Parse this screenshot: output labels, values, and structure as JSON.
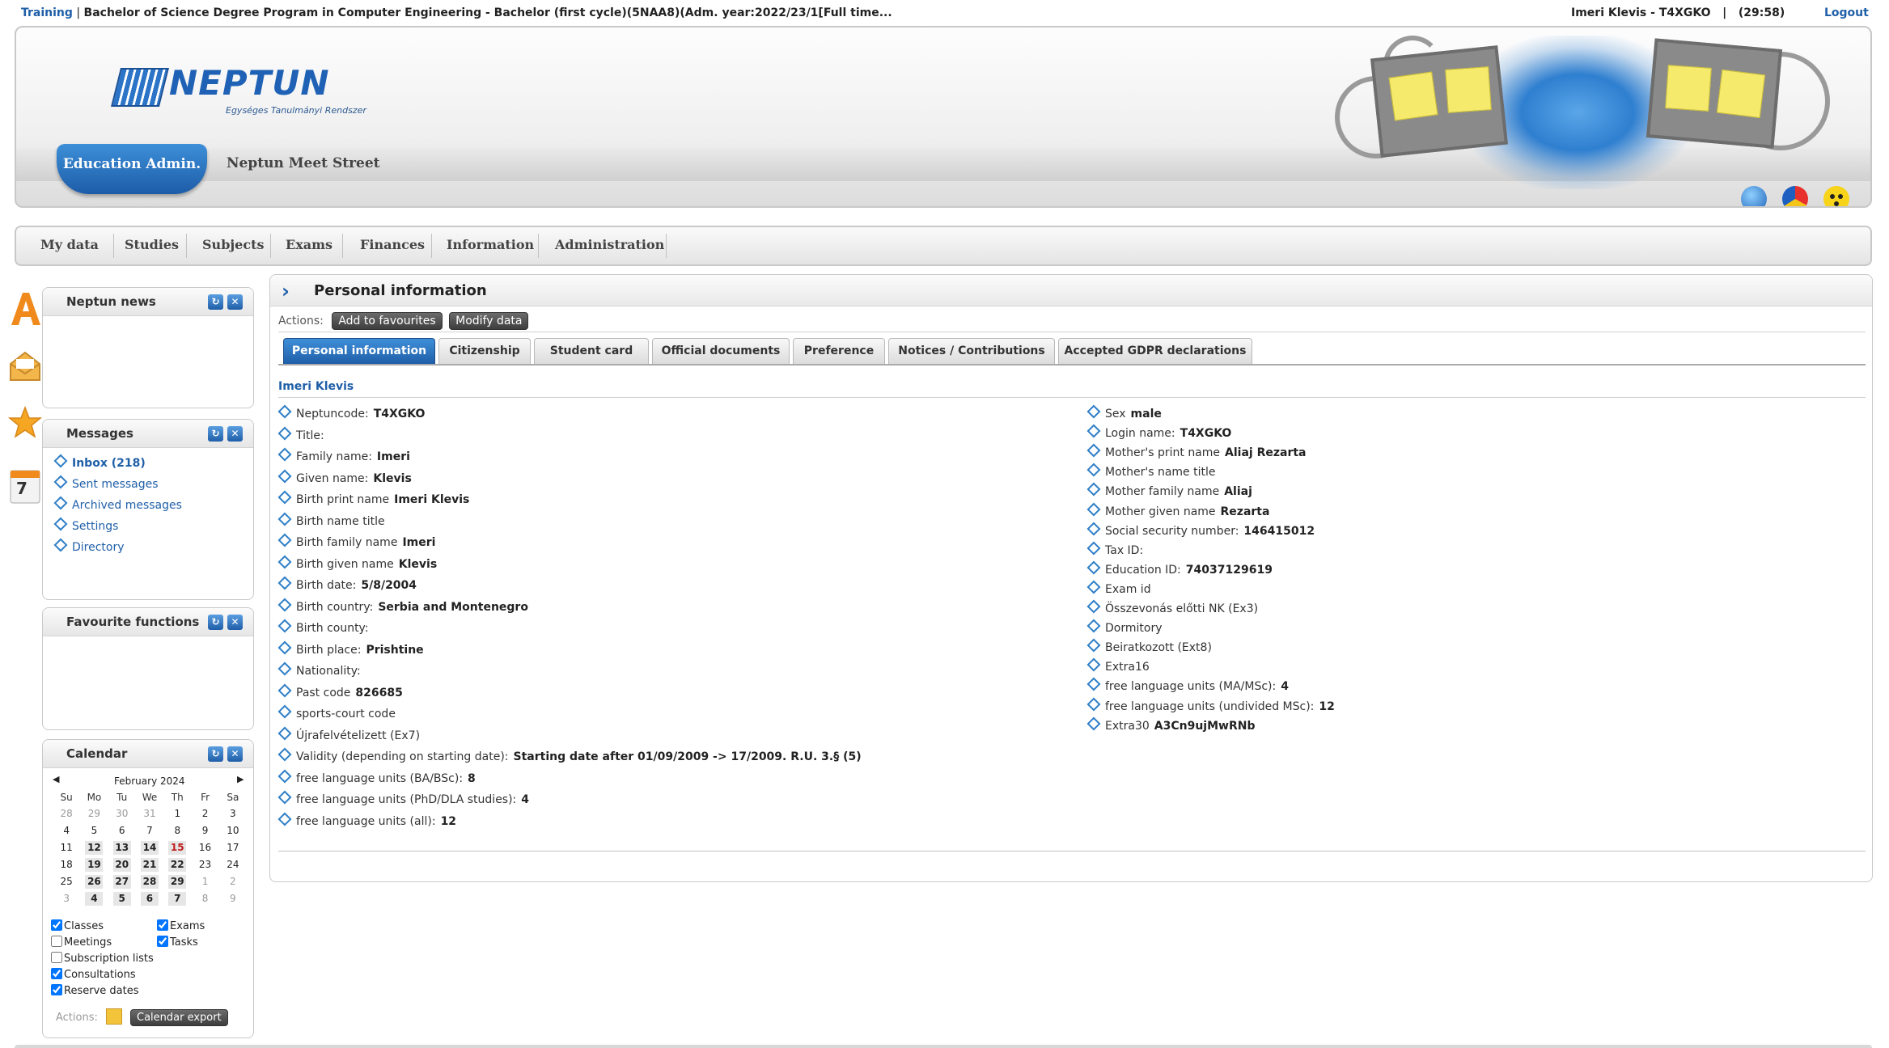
{
  "topbar": {
    "mode": "Training",
    "separator": " | ",
    "program": "Bachelor of Science Degree Program in Computer Engineering - Bachelor (first cycle)(5NAA8)(Adm. year:2022/23/1[Full time...",
    "user": "Imeri Klevis - T4XGKO",
    "user_sep": "|",
    "session_timer": "(29:58)",
    "logout": "Logout"
  },
  "header": {
    "logo_text": "NEPTUN",
    "logo_subtitle": "Egységes Tanulmányi Rendszer",
    "education_admin": "Education Admin.",
    "site_name": "Neptun Meet Street",
    "icons": [
      "globe-icon",
      "color-theme-icon",
      "accessibility-icon"
    ]
  },
  "nav": {
    "items": [
      "My data",
      "Studies",
      "Subjects",
      "Exams",
      "Finances",
      "Information",
      "Administration"
    ]
  },
  "sidebar": {
    "icons": [
      "font-size-icon",
      "inbox-envelope-icon",
      "favourite-star-icon",
      "calendar-icon"
    ],
    "calendar_icon_day": "7",
    "news": {
      "title": "Neptun news"
    },
    "messages": {
      "title": "Messages",
      "items": [
        "Inbox (218)",
        "Sent messages",
        "Archived messages",
        "Settings",
        "Directory"
      ]
    },
    "favourites": {
      "title": "Favourite functions"
    },
    "calendar": {
      "title": "Calendar",
      "month": "February 2024",
      "weekdays": [
        "Su",
        "Mo",
        "Tu",
        "We",
        "Th",
        "Fr",
        "Sa"
      ],
      "weeks": [
        [
          [
            "28",
            "dim"
          ],
          [
            "29",
            "dim"
          ],
          [
            "30",
            "dim"
          ],
          [
            "31",
            "dim"
          ],
          [
            "1",
            ""
          ],
          [
            "2",
            ""
          ],
          [
            "3",
            ""
          ]
        ],
        [
          [
            "4",
            ""
          ],
          [
            "5",
            ""
          ],
          [
            "6",
            ""
          ],
          [
            "7",
            ""
          ],
          [
            "8",
            ""
          ],
          [
            "9",
            ""
          ],
          [
            "10",
            ""
          ]
        ],
        [
          [
            "11",
            ""
          ],
          [
            "12",
            "bold"
          ],
          [
            "13",
            "bold"
          ],
          [
            "14",
            "bold"
          ],
          [
            "15",
            "bold today"
          ],
          [
            "16",
            ""
          ],
          [
            "17",
            ""
          ]
        ],
        [
          [
            "18",
            ""
          ],
          [
            "19",
            "bold"
          ],
          [
            "20",
            "bold"
          ],
          [
            "21",
            "bold"
          ],
          [
            "22",
            "bold"
          ],
          [
            "23",
            ""
          ],
          [
            "24",
            ""
          ]
        ],
        [
          [
            "25",
            ""
          ],
          [
            "26",
            "bold"
          ],
          [
            "27",
            "bold"
          ],
          [
            "28",
            "bold"
          ],
          [
            "29",
            "bold"
          ],
          [
            "1",
            "dim"
          ],
          [
            "2",
            "dim"
          ]
        ],
        [
          [
            "3",
            "dim"
          ],
          [
            "4",
            "bold"
          ],
          [
            "5",
            "bold"
          ],
          [
            "6",
            "bold"
          ],
          [
            "7",
            "bold"
          ],
          [
            "8",
            "dim"
          ],
          [
            "9",
            "dim"
          ]
        ]
      ],
      "filters": {
        "classes": "Classes",
        "exams": "Exams",
        "meetings": "Meetings",
        "tasks": "Tasks",
        "subscription_lists": "Subscription lists",
        "consultations": "Consultations",
        "reserve_dates": "Reserve dates"
      },
      "actions_label": "Actions:",
      "export_label": "Calendar export"
    }
  },
  "main": {
    "title": "Personal information",
    "actions_label": "Actions:",
    "add_favourites": "Add to favourites",
    "modify_data": "Modify data",
    "tabs": [
      "Personal information",
      "Citizenship",
      "Student card",
      "Official documents",
      "Preference",
      "Notices / Contributions",
      "Accepted GDPR declarations"
    ],
    "person_name": "Imeri Klevis",
    "left_fields": [
      {
        "label": "Neptuncode:",
        "value": "T4XGKO"
      },
      {
        "label": "Title:",
        "value": ""
      },
      {
        "label": "Family name:",
        "value": "Imeri"
      },
      {
        "label": "Given name:",
        "value": "Klevis"
      },
      {
        "label": "Birth print name",
        "value": "Imeri Klevis"
      },
      {
        "label": "Birth name title",
        "value": ""
      },
      {
        "label": "Birth family name",
        "value": "Imeri"
      },
      {
        "label": "Birth given name",
        "value": "Klevis"
      },
      {
        "label": "Birth date:",
        "value": "5/8/2004"
      },
      {
        "label": "Birth country:",
        "value": "Serbia and Montenegro"
      },
      {
        "label": "Birth county:",
        "value": ""
      },
      {
        "label": "Birth place:",
        "value": "Prishtine"
      },
      {
        "label": "Nationality:",
        "value": ""
      },
      {
        "label": "Past code",
        "value": "826685"
      },
      {
        "label": "sports-court code",
        "value": ""
      },
      {
        "label": "Újrafelvételizett (Ex7)",
        "value": ""
      },
      {
        "label": "Validity (depending on starting date):",
        "value": "Starting date after 01/09/2009 -> 17/2009. R.U. 3.§ (5)"
      },
      {
        "label": "free language units (BA/BSc):",
        "value": "8"
      },
      {
        "label": "free language units (PhD/DLA studies):",
        "value": "4"
      },
      {
        "label": "free language units (all):",
        "value": "12"
      }
    ],
    "right_fields": [
      {
        "label": "Sex",
        "value": "male"
      },
      {
        "label": "Login name:",
        "value": "T4XGKO"
      },
      {
        "label": "Mother's print name",
        "value": "Aliaj Rezarta"
      },
      {
        "label": "Mother's name title",
        "value": ""
      },
      {
        "label": "Mother family name",
        "value": "Aliaj"
      },
      {
        "label": "Mother given name",
        "value": "Rezarta"
      },
      {
        "label": "Social security number:",
        "value": "146415012"
      },
      {
        "label": "Tax ID:",
        "value": ""
      },
      {
        "label": "Education ID:",
        "value": "74037129619"
      },
      {
        "label": "Exam id",
        "value": ""
      },
      {
        "label": "Összevonás előtti NK (Ex3)",
        "value": ""
      },
      {
        "label": "Dormitory",
        "value": ""
      },
      {
        "label": "Beiratkozott (Ext8)",
        "value": ""
      },
      {
        "label": "Extra16",
        "value": ""
      },
      {
        "label": "free language units (MA/MSc):",
        "value": "4"
      },
      {
        "label": "free language units (undivided MSc):",
        "value": "12"
      },
      {
        "label": "Extra30",
        "value": "A3Cn9ujMwRNb"
      }
    ]
  }
}
